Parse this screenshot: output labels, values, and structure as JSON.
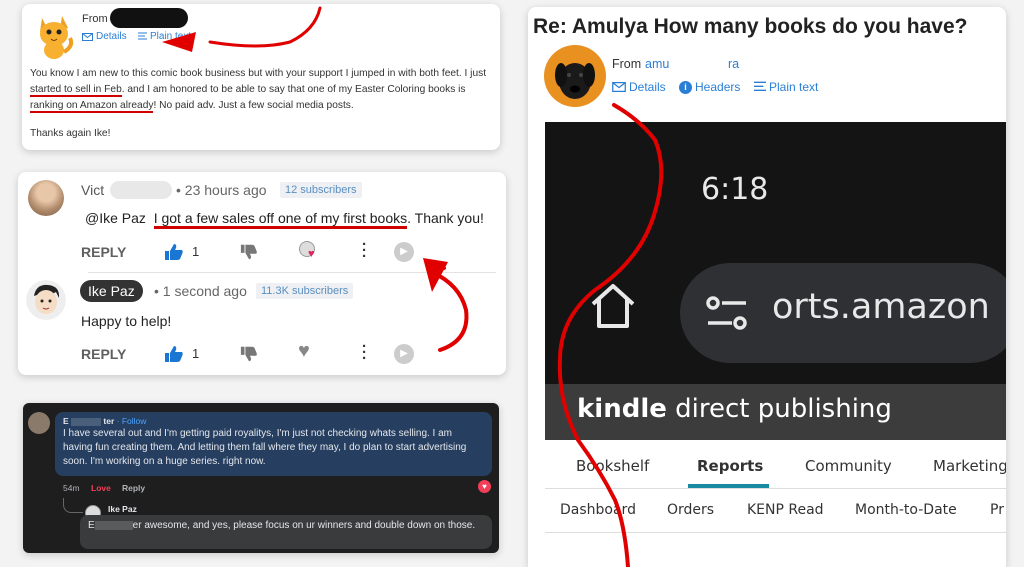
{
  "email1": {
    "from_label": "From",
    "links": {
      "details": "Details",
      "plain_text": "Plain text"
    },
    "body_parts": [
      "You know I am new to this comic book business but with your support I jumped in with both feet. I just ",
      "started to sell in Feb",
      ". and I am honored to be able to say that one of my Easter Coloring books is ",
      "ranking on Amazon already",
      "! No paid adv. Just a few social media posts."
    ],
    "thanks": "Thanks again Ike!"
  },
  "youtube": {
    "c1": {
      "name": "Vict",
      "time": "• 23 hours ago",
      "subs": "12 subscribers",
      "mention": "@Ike Paz",
      "text": "I got a few sales off one of my first books",
      "text_end": ". Thank you!",
      "reply": "REPLY",
      "likes": "1"
    },
    "c2": {
      "name": "Ike Paz",
      "time": "• 1 second ago",
      "subs": "11.3K subscribers",
      "text": "Happy to help!",
      "reply": "REPLY",
      "likes": "1"
    }
  },
  "facebook": {
    "c1": {
      "name_start": "E",
      "name_end": "ter",
      "follow": "· Follow",
      "text": "I have several out and I'm getting paid royalitys, I'm just not checking whats selling. I am having fun creating them. And letting them fall where they may, I do plan to start advertising soon. I'm working on a huge series. right now.",
      "time": "54m",
      "love": "Love",
      "reply": "Reply"
    },
    "c2": {
      "name": "Ike Paz",
      "text_start": "E",
      "text_mid": "er awesome, and yes, please focus on ur winners and double down on those."
    }
  },
  "email2": {
    "subject": "Re: Amulya How many books do you have?",
    "from_label": "From",
    "from_start": "amu",
    "from_end": "ra",
    "links": {
      "details": "Details",
      "headers": "Headers",
      "plain_text": "Plain text"
    }
  },
  "kdp": {
    "clock": "6:18",
    "url": "orts.amazon",
    "logo_bold": "kindle",
    "logo_rest": " direct publishing",
    "tabs": [
      "Bookshelf",
      "Reports",
      "Community",
      "Marketing"
    ],
    "subtabs": [
      "Dashboard",
      "Orders",
      "KENP Read",
      "Month-to-Date",
      "Pr"
    ]
  },
  "colors": {
    "annotation_red": "#e00000",
    "link_blue": "#2a7fd4",
    "kdp_teal": "#1a8aa0"
  }
}
